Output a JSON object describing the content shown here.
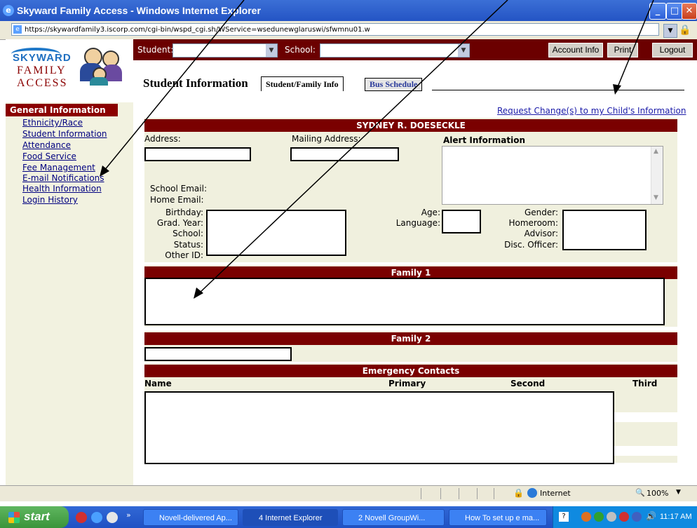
{
  "window": {
    "title": "Skyward Family Access - Windows Internet Explorer",
    "url": "https://skywardfamily3.iscorp.com/cgi-bin/wspd_cgi.sh/WService=wsedunewglaruswi/sfwmnu01.w"
  },
  "logo": {
    "line1": "SKYWARD",
    "line2": "FAMILY",
    "line3": "ACCESS"
  },
  "sidebar": {
    "header": "General Information",
    "items": [
      {
        "label": "Ethnicity/Race"
      },
      {
        "label": "Student Information"
      },
      {
        "label": "Attendance"
      },
      {
        "label": "Food Service"
      },
      {
        "label": "Fee Management"
      },
      {
        "label": "E-mail Notifications"
      },
      {
        "label": "Health Information"
      },
      {
        "label": "Login History"
      }
    ]
  },
  "topbar": {
    "student_label": "Student:",
    "school_label": "School:",
    "account_info": "Account Info",
    "print": "Print",
    "logout": "Logout"
  },
  "page": {
    "title": "Student Information",
    "tabs": [
      {
        "label": "Student/Family Info",
        "active": true
      },
      {
        "label": "Bus Schedule",
        "active": false
      }
    ],
    "request_link": "Request Change(s) to my Child's Information",
    "student_name": "SYDNEY R. DOESECKLE"
  },
  "student": {
    "address_label": "Address:",
    "mailing_label": "Mailing Address:",
    "alert_label": "Alert Information",
    "school_email_label": "School Email:",
    "home_email_label": "Home Email:",
    "birthday_label": "Birthday:",
    "grad_year_label": "Grad. Year:",
    "school_label": "School:",
    "status_label": "Status:",
    "other_id_label": "Other ID:",
    "age_label": "Age:",
    "language_label": "Language:",
    "gender_label": "Gender:",
    "homeroom_label": "Homeroom:",
    "advisor_label": "Advisor:",
    "disc_officer_label": "Disc. Officer:"
  },
  "sections": {
    "family1": "Family 1",
    "family2": "Family 2",
    "emergency": "Emergency Contacts"
  },
  "emergency_columns": {
    "name": "Name",
    "primary": "Primary",
    "second": "Second",
    "third": "Third"
  },
  "statusbar": {
    "zone": "Internet",
    "zoom": "100%"
  },
  "taskbar": {
    "start": "start",
    "items": [
      {
        "label": "Novell-delivered Ap..."
      },
      {
        "label": "4 Internet Explorer"
      },
      {
        "label": "2 Novell GroupWi..."
      },
      {
        "label": "How To set up e ma..."
      }
    ],
    "clock": "11:17 AM"
  },
  "colors": {
    "maroon": "#7a0000",
    "panel": "#f0f0de",
    "link": "#000080"
  }
}
